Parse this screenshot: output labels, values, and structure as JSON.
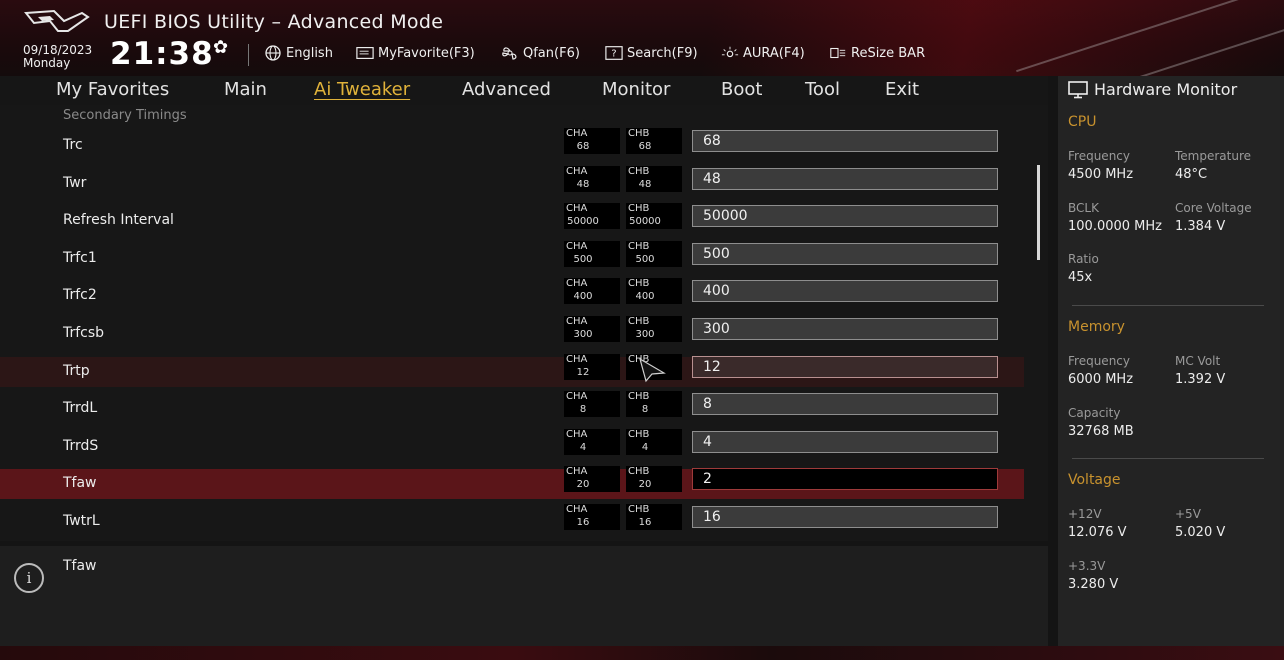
{
  "header": {
    "title": "UEFI BIOS Utility – Advanced Mode",
    "date": "09/18/2023",
    "day": "Monday",
    "time": "21:38",
    "toolbar": {
      "language": "English",
      "myfavorite": "MyFavorite(F3)",
      "qfan": "Qfan(F6)",
      "search": "Search(F9)",
      "aura": "AURA(F4)",
      "resizebar": "ReSize BAR"
    }
  },
  "nav": {
    "tabs": [
      "My Favorites",
      "Main",
      "Ai Tweaker",
      "Advanced",
      "Monitor",
      "Boot",
      "Tool",
      "Exit"
    ],
    "active": "Ai Tweaker"
  },
  "main": {
    "section_title": "Secondary Timings",
    "cha_label": "CHA",
    "chb_label": "CHB",
    "rows": [
      {
        "label": "Trc",
        "cha": "68",
        "chb": "68",
        "value": "68"
      },
      {
        "label": "Twr",
        "cha": "48",
        "chb": "48",
        "value": "48"
      },
      {
        "label": "Refresh Interval",
        "cha": "50000",
        "chb": "50000",
        "value": "50000"
      },
      {
        "label": "Trfc1",
        "cha": "500",
        "chb": "500",
        "value": "500"
      },
      {
        "label": "Trfc2",
        "cha": "400",
        "chb": "400",
        "value": "400"
      },
      {
        "label": "Trfcsb",
        "cha": "300",
        "chb": "300",
        "value": "300"
      },
      {
        "label": "Trtp",
        "cha": "12",
        "chb": "",
        "value": "12"
      },
      {
        "label": "TrrdL",
        "cha": "8",
        "chb": "8",
        "value": "8"
      },
      {
        "label": "TrrdS",
        "cha": "4",
        "chb": "4",
        "value": "4"
      },
      {
        "label": "Tfaw",
        "cha": "20",
        "chb": "20",
        "value": "2"
      },
      {
        "label": "TwtrL",
        "cha": "16",
        "chb": "16",
        "value": "16"
      }
    ]
  },
  "help": {
    "text": "Tfaw"
  },
  "hardware_monitor": {
    "title": "Hardware Monitor",
    "cpu": {
      "heading": "CPU",
      "frequency_label": "Frequency",
      "frequency": "4500 MHz",
      "temperature_label": "Temperature",
      "temperature": "48°C",
      "bclk_label": "BCLK",
      "bclk": "100.0000 MHz",
      "core_voltage_label": "Core Voltage",
      "core_voltage": "1.384 V",
      "ratio_label": "Ratio",
      "ratio": "45x"
    },
    "memory": {
      "heading": "Memory",
      "frequency_label": "Frequency",
      "frequency": "6000 MHz",
      "mc_volt_label": "MC Volt",
      "mc_volt": "1.392 V",
      "capacity_label": "Capacity",
      "capacity": "32768 MB"
    },
    "voltage": {
      "heading": "Voltage",
      "v12_label": "+12V",
      "v12": "12.076 V",
      "v5_label": "+5V",
      "v5": "5.020 V",
      "v33_label": "+3.3V",
      "v33": "3.280 V"
    }
  },
  "colors": {
    "accent": "#e0b23a",
    "selected_row": "#5b1519",
    "section_heading": "#c8922e"
  }
}
